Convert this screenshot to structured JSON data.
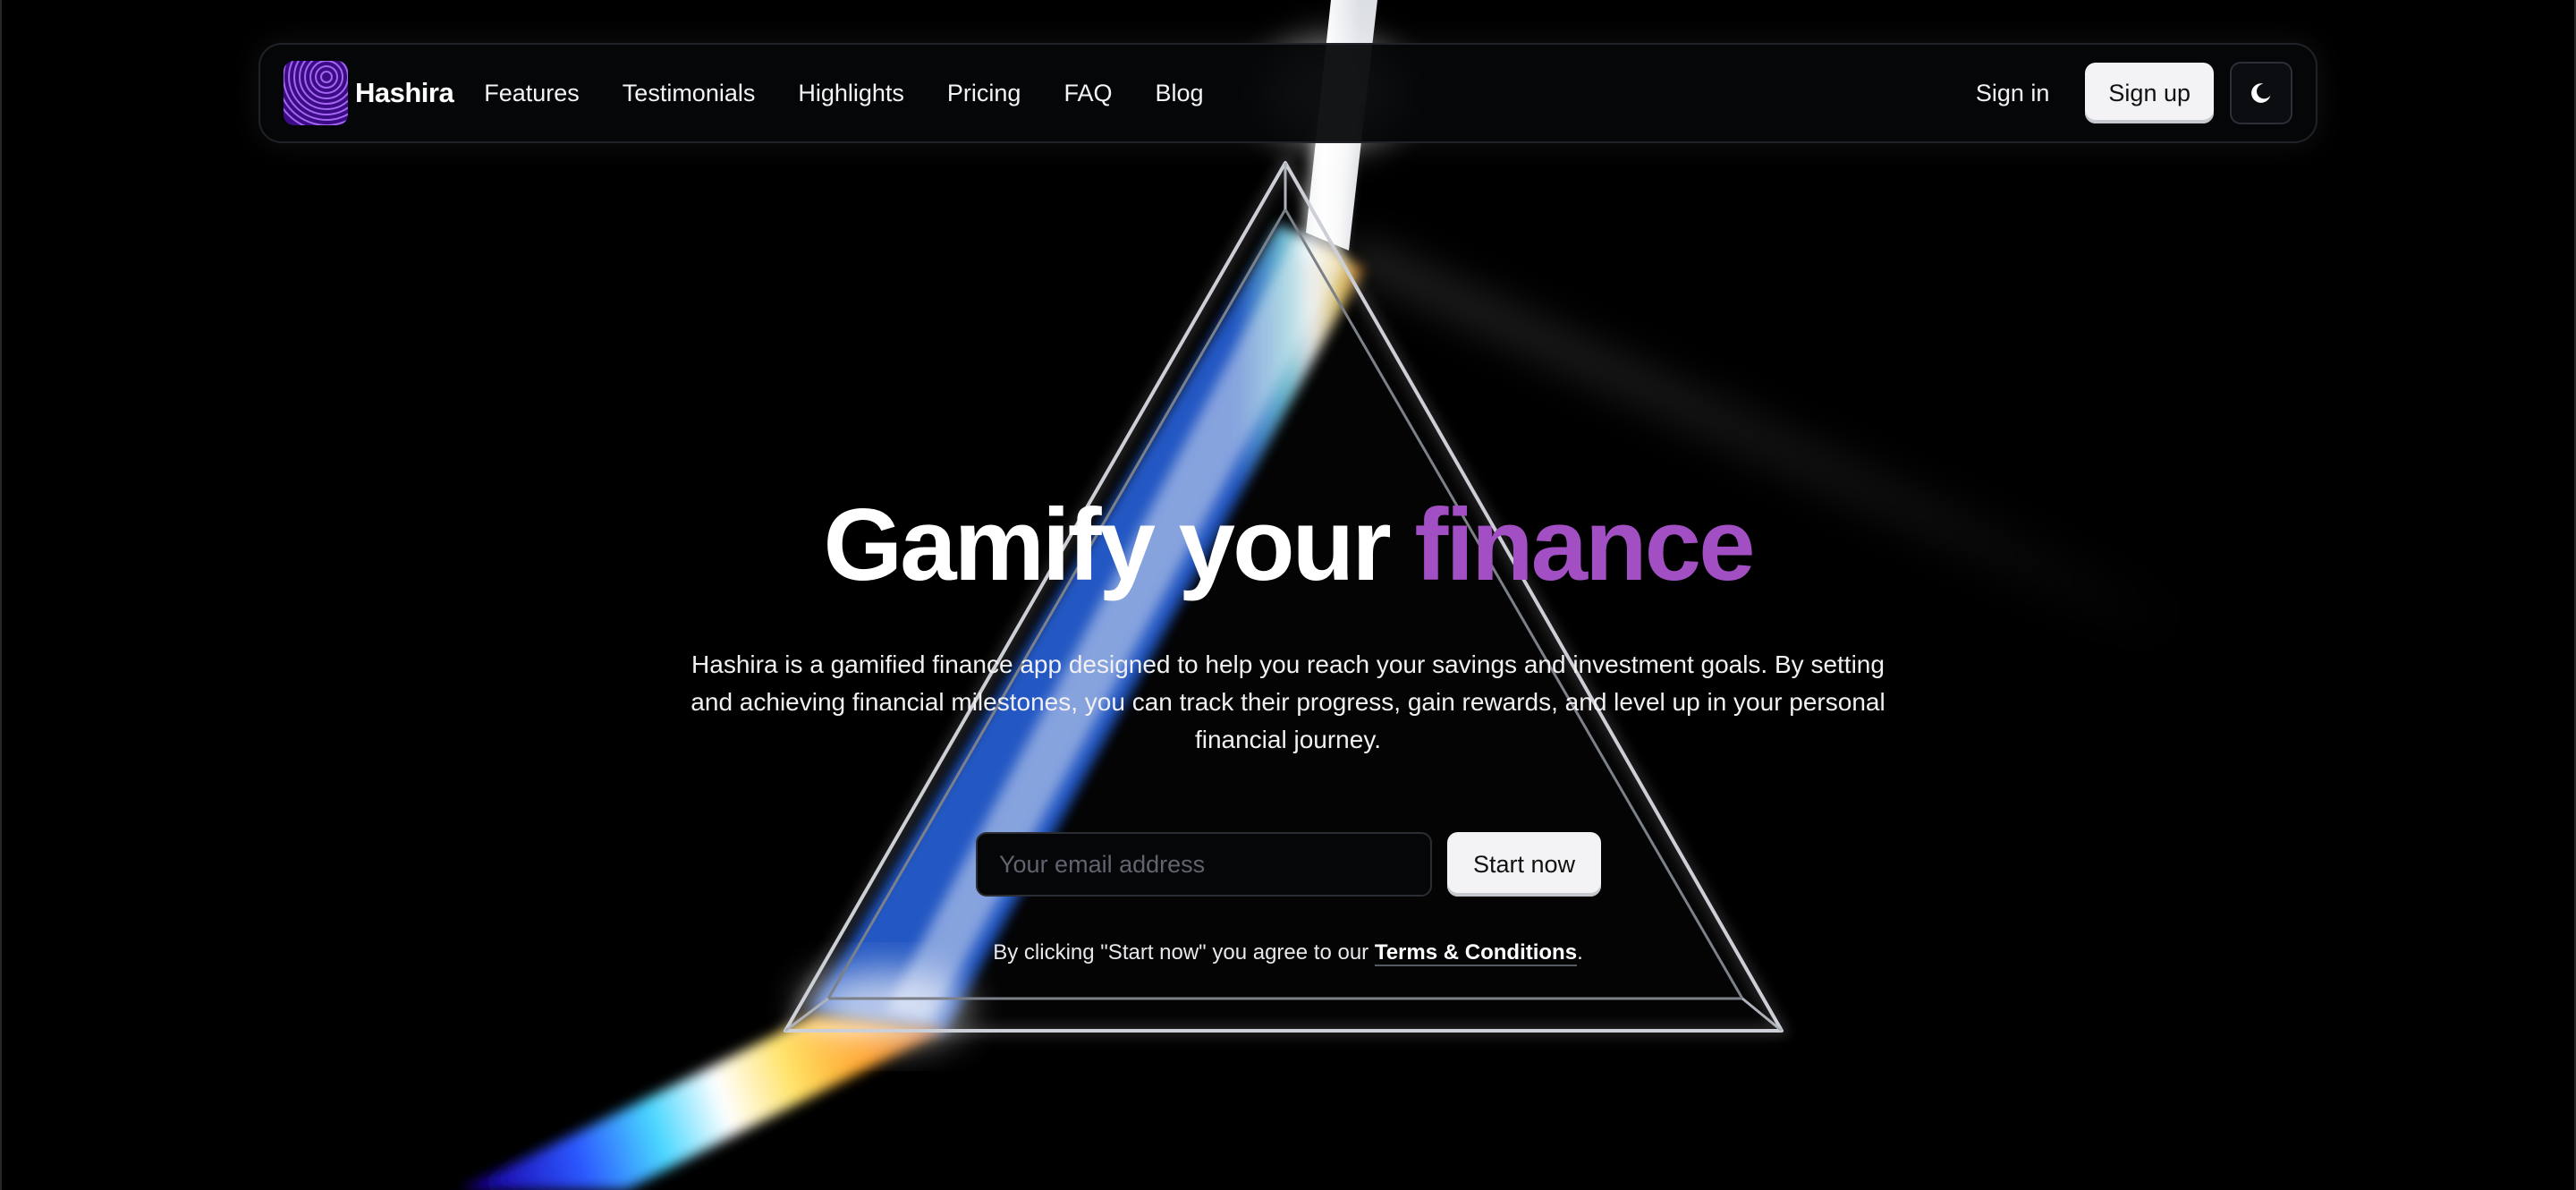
{
  "brand": {
    "name": "Hashira",
    "logo_icon": "fingerprint-icon"
  },
  "nav": {
    "links": [
      "Features",
      "Testimonials",
      "Highlights",
      "Pricing",
      "FAQ",
      "Blog"
    ],
    "sign_in": "Sign in",
    "sign_up": "Sign up",
    "theme_toggle_icon": "moon-icon"
  },
  "hero": {
    "title_lead": "Gamify your",
    "title_accent": "finance",
    "description": "Hashira is a gamified finance app designed to help you reach your savings and investment goals. By setting and achieving financial milestones, you can track their progress, gain rewards, and level up in your personal financial journey.",
    "email_placeholder": "Your email address",
    "cta_label": "Start now",
    "terms_prefix": "By clicking \"Start now\" you agree to our ",
    "terms_link": "Terms & Conditions",
    "terms_suffix": "."
  },
  "colors": {
    "background": "#000000",
    "accent": "#a24fc4",
    "logo_bg": "#3c0c86",
    "button_bg": "#f3f3f6"
  }
}
